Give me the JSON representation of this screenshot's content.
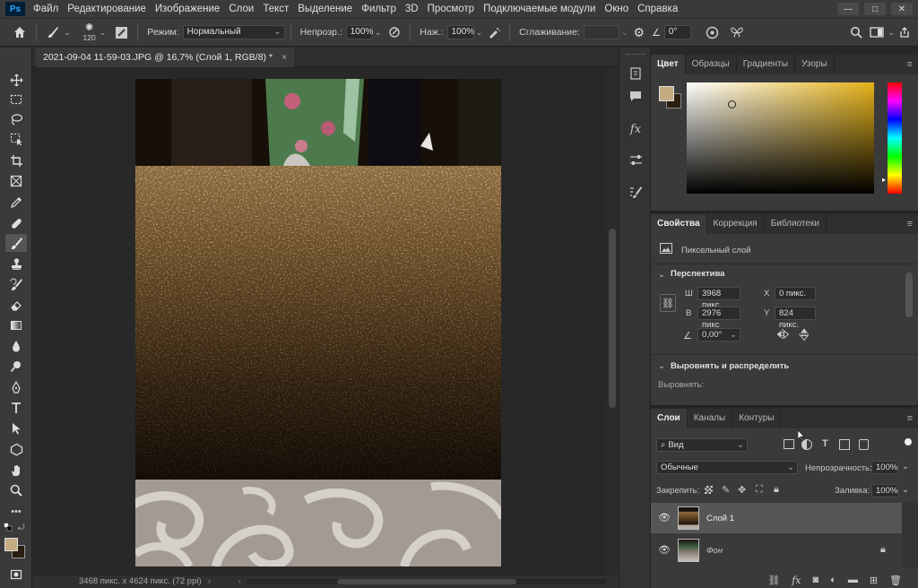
{
  "menubar": {
    "logo": "Ps",
    "items": [
      "Файл",
      "Редактирование",
      "Изображение",
      "Слои",
      "Текст",
      "Выделение",
      "Фильтр",
      "3D",
      "Просмотр",
      "Подключаемые модули",
      "Окно",
      "Справка"
    ],
    "window_controls": [
      "—",
      "□",
      "✕"
    ]
  },
  "options_bar": {
    "brush_size": "120",
    "mode_label": "Режим:",
    "mode_value": "Нормальный",
    "opacity_label": "Непрозр.:",
    "opacity_value": "100%",
    "flow_label": "Наж.:",
    "flow_value": "100%",
    "smoothing_label": "Сглаживание:",
    "angle_value": "0°"
  },
  "document": {
    "tab_title": "2021-09-04 11-59-03.JPG @ 16,7% (Слой 1, RGB/8) *",
    "close": "×",
    "status": "3468 пикс. x 4624 пикс. (72 ppi)"
  },
  "color_panel": {
    "tabs": [
      "Цвет",
      "Образцы",
      "Градиенты",
      "Узоры"
    ],
    "active_tab": 0,
    "foreground": "#c4ab82",
    "background": "#2b1d10",
    "hue_color": "#e5b21a"
  },
  "properties_panel": {
    "tabs": [
      "Свойства",
      "Коррекция",
      "Библиотеки"
    ],
    "active_tab": 0,
    "layer_type": "Пиксельный слой",
    "section_perspective": "Перспектива",
    "w_label": "Ш",
    "w_value": "3968 пикс",
    "h_label": "В",
    "h_value": "2976 пикс",
    "x_label": "X",
    "x_value": "0 пикс.",
    "y_label": "Y",
    "y_value": "824 пикс.",
    "angle_value": "0,00°",
    "section_align": "Выровнять и распределить",
    "align_label": "Выровнять:"
  },
  "layers_panel": {
    "tabs": [
      "Слои",
      "Каналы",
      "Контуры"
    ],
    "active_tab": 0,
    "filter_kind": "Вид",
    "blend_mode": "Обычные",
    "opacity_label": "Непрозрачность:",
    "opacity_value": "100%",
    "lock_label": "Закрепить:",
    "fill_label": "Заливка:",
    "fill_value": "100%",
    "layers": [
      {
        "name": "Слой 1",
        "selected": true,
        "locked": false
      },
      {
        "name": "Фон",
        "selected": false,
        "locked": true
      }
    ]
  },
  "accent_color": "#31a8ff"
}
